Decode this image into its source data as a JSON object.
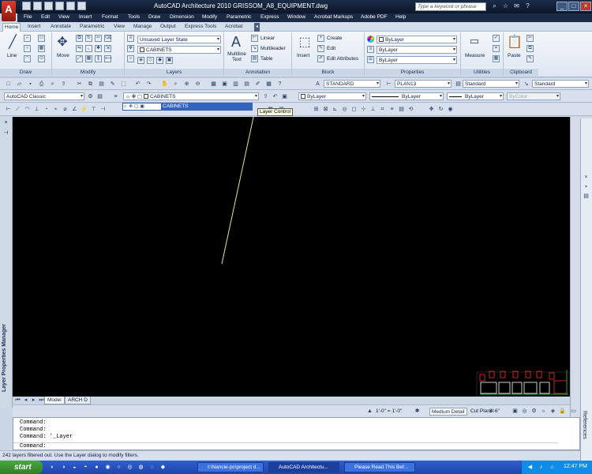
{
  "window": {
    "title": "AutoCAD Architecture 2010    GRISSOM_A8_EQUIPMENT.dwg",
    "app_logo": "A",
    "search_placeholder": "Type a keyword or phrase"
  },
  "menubar": [
    "File",
    "Edit",
    "View",
    "Insert",
    "Format",
    "Tools",
    "Draw",
    "Dimension",
    "Modify",
    "Parametric",
    "Express",
    "Window",
    "Acrobat Markups",
    "Adobe PDF",
    "Help"
  ],
  "ribbon": {
    "tabs": [
      "Home",
      "Insert",
      "Annotate",
      "Parametric",
      "View",
      "Manage",
      "Output",
      "Express Tools",
      "Acrobat"
    ],
    "active_tab": "Home",
    "panels": {
      "draw": "Draw",
      "modify": "Modify",
      "layers": "Layers",
      "annotation": "Annotation",
      "block": "Block",
      "properties": "Properties",
      "utilities": "Utilities",
      "clipboard": "Clipboard"
    },
    "draw_line": "Line",
    "modify_move": "Move",
    "layer_state": "Unsaved Layer State",
    "layer_current": "CABINETS",
    "multiline_text": "Multiline Text",
    "linear": "Linear",
    "multileader": "Multileader",
    "table": "Table",
    "insert": "Insert",
    "create": "Create",
    "edit": "Edit",
    "edit_attributes": "Edit Attributes",
    "prop_color": "ByLayer",
    "prop_linetype": "ByLayer",
    "prop_lineweight": "ByLayer",
    "measure": "Measure",
    "paste": "Paste"
  },
  "toolbar1": {
    "text_style": "STANDARD",
    "dim_style": "PLAN13",
    "table_style": "Standard",
    "mleader_style": "Standard"
  },
  "toolbar2": {
    "workspace": "AutoCAD Classic",
    "layer": "CABINETS",
    "color": "ByLayer",
    "linetype": "ByLayer",
    "lineweight": "ByLayer",
    "plotstyle": "ByColor"
  },
  "layer_dropdown_selected": "CABINETS",
  "tooltip": "Layer Control",
  "left_palette": "Layer Properties Manager",
  "right_palette": "References",
  "layout_tabs": [
    "Model",
    "ARCH D"
  ],
  "status": {
    "scale": "1'-0\" = 1'-0\"",
    "detail": "Medium Detail",
    "cut_plane_label": "Cut Plane:",
    "cut_plane_value": "3'-6\""
  },
  "command_history": [
    "Command:",
    "Command:",
    "Command: '_Layer",
    "Command:"
  ],
  "status_message": "242 layers filtered out.  Use the Layer dialog to modify filters.",
  "taskbar": {
    "start": "start",
    "tasks": [
      "I:\\Nancie-pc\\project d...",
      "AutoCAD Architectu...",
      "Please Read This Bef..."
    ],
    "clock": "12:47 PM"
  },
  "colors": {
    "drawing_bg": "#000000",
    "title_bg": "#0b1628",
    "ribbon_bg": "#dfe7f2",
    "accent_line": "#e6e68a"
  }
}
